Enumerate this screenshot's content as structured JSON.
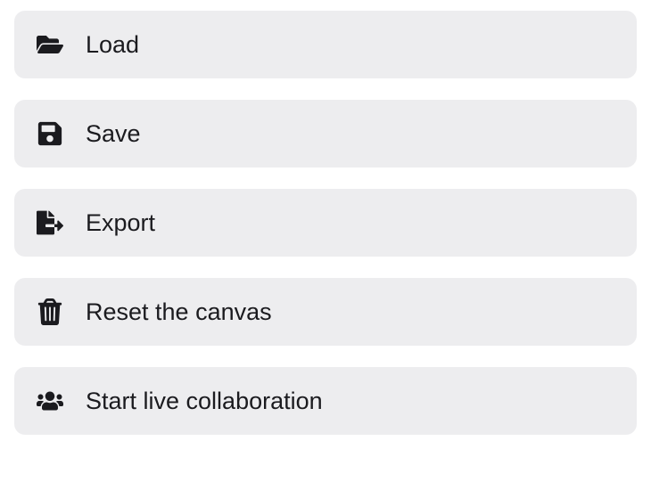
{
  "menu": {
    "items": [
      {
        "label": "Load",
        "icon": "folder-open-icon"
      },
      {
        "label": "Save",
        "icon": "save-icon"
      },
      {
        "label": "Export",
        "icon": "export-icon"
      },
      {
        "label": "Reset the canvas",
        "icon": "trash-icon"
      },
      {
        "label": "Start live collaboration",
        "icon": "users-icon"
      }
    ]
  }
}
